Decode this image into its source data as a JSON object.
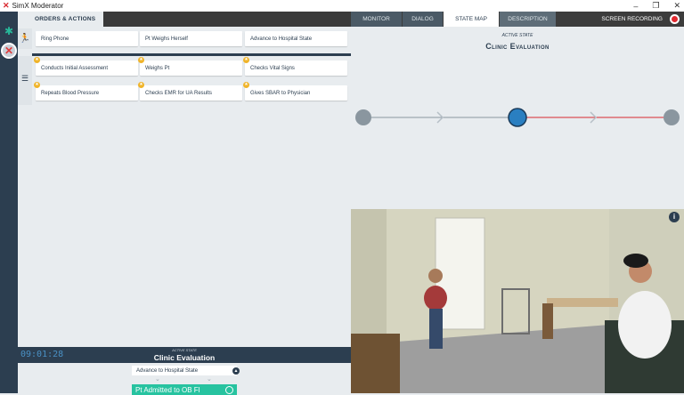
{
  "titlebar": {
    "app_title": "SimX Moderator",
    "minimize": "–",
    "restore": "❐",
    "close": "✕"
  },
  "left_nav": {
    "orders_tab": "ORDERS & ACTIONS"
  },
  "right_tabs": [
    {
      "label": "MONITOR"
    },
    {
      "label": "DIALOG"
    },
    {
      "label": "STATE MAP"
    },
    {
      "label": "DESCRIPTION"
    }
  ],
  "screen_recording": "SCREEN RECORDING",
  "actions": {
    "row1": [
      "Ring Phone",
      "Pt Weighs Herself",
      "Advance to Hospital State"
    ],
    "checklist_row1": [
      "Conducts Initial Assessment",
      "Weighs Pt",
      "Checks Vital Signs"
    ],
    "checklist_row2": [
      "Repeats Blood Pressure",
      "Checks EMR for UA Results",
      "Gives SBAR to Physician"
    ]
  },
  "bottom": {
    "timer": "09:01:28",
    "active_state_label": "ACTIVE STATE",
    "active_state": "Clinic Evaluation",
    "advance_option": "Advance to Hospital State",
    "next_state_button": "Pt Admitted to OB Fl"
  },
  "state_map": {
    "active_state_label": "ACTIVE STATE",
    "active_state": "Clinic Evaluation",
    "nodes": [
      "past",
      "past",
      "active",
      "future",
      "future"
    ]
  },
  "colors": {
    "dark_navy": "#2c3e50",
    "accent_green": "#27c3a0",
    "active_blue": "#2a7fc1",
    "record_red": "#e0282f",
    "star_yellow": "#f0b429"
  }
}
